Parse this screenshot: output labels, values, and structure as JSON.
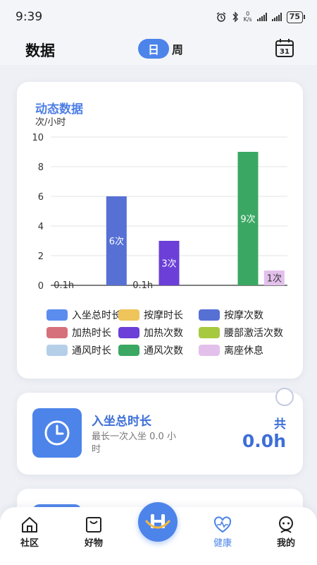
{
  "status_bar": {
    "time": "9:39",
    "net_speed_top": "0",
    "net_speed_unit": "K/s",
    "battery": "75"
  },
  "header": {
    "title": "数据",
    "tab_day": "日",
    "tab_week": "周",
    "calendar_day": "31"
  },
  "chart_card": {
    "title": "动态数据",
    "unit": "次/小时"
  },
  "chart_data": {
    "type": "bar",
    "title": "动态数据",
    "ylabel": "次/小时",
    "ylim": [
      0,
      10
    ],
    "yticks": [
      "0",
      "2",
      "4",
      "6",
      "8",
      "10"
    ],
    "grid": true,
    "legend_position": "bottom",
    "series": [
      {
        "name": "入坐总时长",
        "value": 0,
        "label": "0.1h",
        "color": "#5b8def",
        "text_color": "#333"
      },
      {
        "name": "按摩时长",
        "value": 0,
        "label": "",
        "color": "#efc45b",
        "text_color": "#333"
      },
      {
        "name": "按摩次数",
        "value": 6,
        "label": "6次",
        "color": "#5670d4",
        "text_color": "#ffffff"
      },
      {
        "name": "加热时长",
        "value": 0,
        "label": "0.1h",
        "color": "#d6707a",
        "text_color": "#333"
      },
      {
        "name": "加热次数",
        "value": 3,
        "label": "3次",
        "color": "#6b3fd8",
        "text_color": "#ffffff"
      },
      {
        "name": "腰部激活次数",
        "value": 0,
        "label": "",
        "color": "#a7c93f",
        "text_color": "#333"
      },
      {
        "name": "通风时长",
        "value": 0,
        "label": "",
        "color": "#b5cfe9",
        "text_color": "#333"
      },
      {
        "name": "通风次数",
        "value": 9,
        "label": "9次",
        "color": "#3aa863",
        "text_color": "#ffffff"
      },
      {
        "name": "离座休息",
        "value": 1,
        "label": "1次",
        "color": "#e3c0ec",
        "text_color": "#333"
      }
    ]
  },
  "sit_card": {
    "title": "入坐总时长",
    "desc": "最长一次入坐 0.0 小时",
    "total_label": "共",
    "total_value": "0.0h"
  },
  "tabbar": {
    "items": [
      {
        "label": "社区",
        "icon": "home-icon"
      },
      {
        "label": "好物",
        "icon": "shopping-bag-icon"
      },
      {
        "label": "健康",
        "icon": "heart-pulse-icon",
        "active": true
      },
      {
        "label": "我的",
        "icon": "profile-icon"
      }
    ],
    "center_icon": "logo-h-icon"
  },
  "colors": {
    "accent": "#4d84ea",
    "title_blue": "#3e6fd8"
  }
}
